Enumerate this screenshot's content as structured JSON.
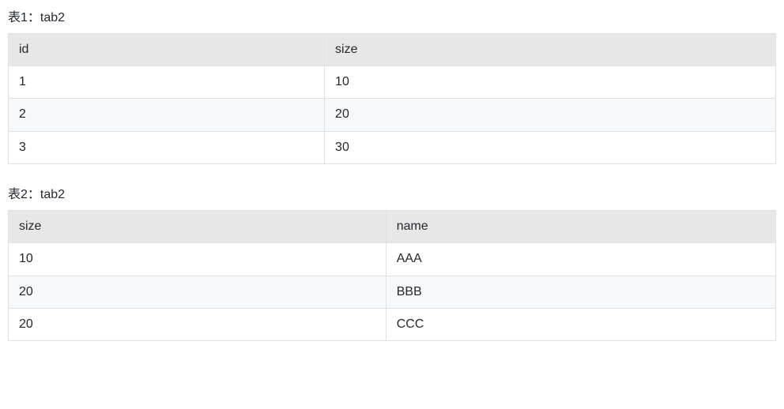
{
  "table1": {
    "caption": "表1：tab2",
    "headers": [
      "id",
      "size"
    ],
    "rows": [
      [
        "1",
        "10"
      ],
      [
        "2",
        "20"
      ],
      [
        "3",
        "30"
      ]
    ]
  },
  "table2": {
    "caption": "表2：tab2",
    "headers": [
      "size",
      "name"
    ],
    "rows": [
      [
        "10",
        "AAA"
      ],
      [
        "20",
        "BBB"
      ],
      [
        "20",
        "CCC"
      ]
    ]
  }
}
